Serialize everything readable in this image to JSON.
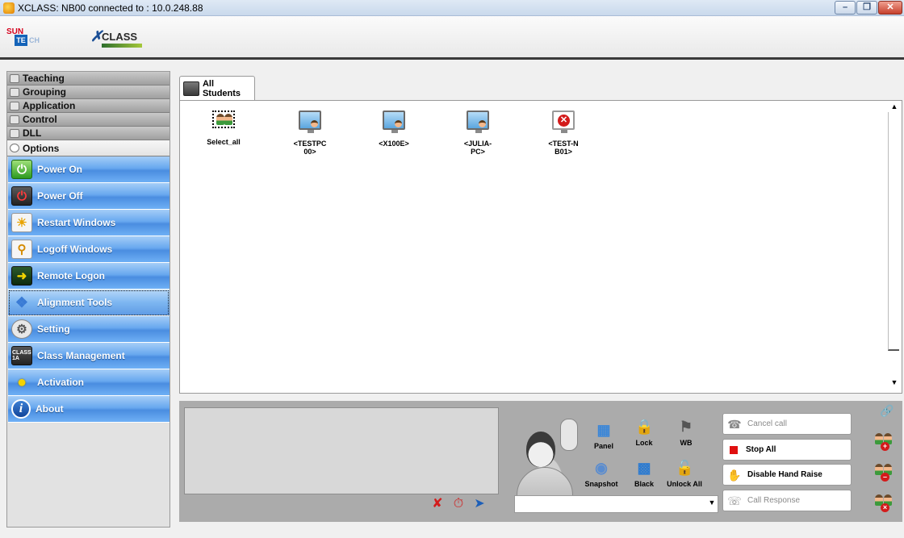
{
  "window": {
    "title": "XCLASS: NB00 connected to : 10.0.248.88",
    "buttons": [
      "minimize",
      "restore",
      "close"
    ]
  },
  "brand": {
    "sun": "SUN",
    "te": "TE",
    "ch": "CH",
    "xclass": "CLASS"
  },
  "sidebar": {
    "categories": [
      {
        "label": "Teaching",
        "icon": "teaching-icon"
      },
      {
        "label": "Grouping",
        "icon": "grouping-icon"
      },
      {
        "label": "Application",
        "icon": "application-icon"
      },
      {
        "label": "Control",
        "icon": "control-icon"
      },
      {
        "label": "DLL",
        "icon": "dll-icon"
      },
      {
        "label": "Options",
        "icon": "options-icon",
        "active": true
      }
    ],
    "options": [
      {
        "label": "Power On",
        "icon": "power-on-icon"
      },
      {
        "label": "Power Off",
        "icon": "power-off-icon"
      },
      {
        "label": "Restart Windows",
        "icon": "restart-icon"
      },
      {
        "label": "Logoff Windows",
        "icon": "logoff-icon"
      },
      {
        "label": "Remote Logon",
        "icon": "remote-logon-icon"
      },
      {
        "label": "Alignment Tools",
        "icon": "alignment-tools-icon",
        "selected": true
      },
      {
        "label": "Setting",
        "icon": "setting-icon"
      },
      {
        "label": "Class Management",
        "icon": "class-management-icon"
      },
      {
        "label": "Activation",
        "icon": "activation-icon"
      },
      {
        "label": "About",
        "icon": "about-icon"
      }
    ],
    "class_icon_text": "CLASS 1A"
  },
  "tab": {
    "label": "All Students"
  },
  "students": [
    {
      "label": "Select_all",
      "type": "select-all"
    },
    {
      "label": "<TESTPC\n00>",
      "type": "online"
    },
    {
      "label": "<X100E>",
      "type": "online"
    },
    {
      "label": "<JULIA-\nPC>",
      "type": "online"
    },
    {
      "label": "<TEST-N\nB01>",
      "type": "error"
    }
  ],
  "tools": {
    "panel": "Panel",
    "lock": "Lock",
    "wb": "WB",
    "snapshot": "Snapshot",
    "black": "Black",
    "unlock_all": "Unlock All"
  },
  "actions": {
    "cancel_call": "Cancel call",
    "stop_all": "Stop All",
    "disable_hand_raise": "Disable Hand Raise",
    "call_response": "Call Response"
  },
  "combo": {
    "value": ""
  },
  "colors": {
    "option_blue": "#4a8de0",
    "accent_red": "#e01010"
  }
}
